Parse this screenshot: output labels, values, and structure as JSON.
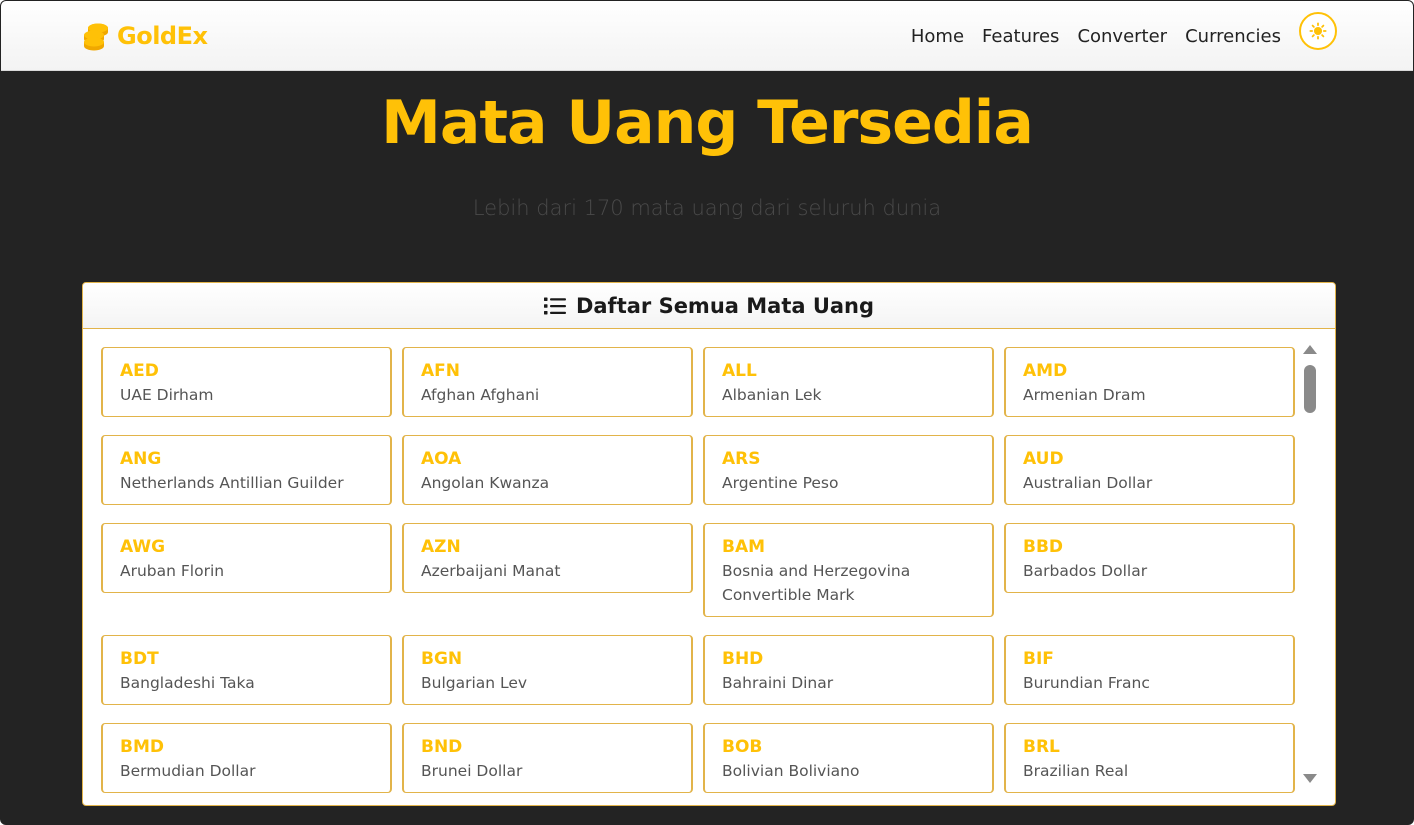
{
  "navbar": {
    "brand": "GoldEx",
    "links": [
      "Home",
      "Features",
      "Converter",
      "Currencies"
    ],
    "theme_toggle_icon": "sun-icon"
  },
  "hero": {
    "title": "Mata Uang Tersedia",
    "subtitle": "Lebih dari 170 mata uang dari seluruh dunia"
  },
  "panel": {
    "icon": "list-icon",
    "title": "Daftar Semua Mata Uang",
    "currencies": [
      {
        "code": "AED",
        "name": "UAE Dirham"
      },
      {
        "code": "AFN",
        "name": "Afghan Afghani"
      },
      {
        "code": "ALL",
        "name": "Albanian Lek"
      },
      {
        "code": "AMD",
        "name": "Armenian Dram"
      },
      {
        "code": "ANG",
        "name": "Netherlands Antillian Guilder"
      },
      {
        "code": "AOA",
        "name": "Angolan Kwanza"
      },
      {
        "code": "ARS",
        "name": "Argentine Peso"
      },
      {
        "code": "AUD",
        "name": "Australian Dollar"
      },
      {
        "code": "AWG",
        "name": "Aruban Florin"
      },
      {
        "code": "AZN",
        "name": "Azerbaijani Manat"
      },
      {
        "code": "BAM",
        "name": "Bosnia and Herzegovina Convertible Mark"
      },
      {
        "code": "BBD",
        "name": "Barbados Dollar"
      },
      {
        "code": "BDT",
        "name": "Bangladeshi Taka"
      },
      {
        "code": "BGN",
        "name": "Bulgarian Lev"
      },
      {
        "code": "BHD",
        "name": "Bahraini Dinar"
      },
      {
        "code": "BIF",
        "name": "Burundian Franc"
      },
      {
        "code": "BMD",
        "name": "Bermudian Dollar"
      },
      {
        "code": "BND",
        "name": "Brunei Dollar"
      },
      {
        "code": "BOB",
        "name": "Bolivian Boliviano"
      },
      {
        "code": "BRL",
        "name": "Brazilian Real"
      }
    ]
  },
  "colors": {
    "accent": "#ffc107",
    "background": "#232323",
    "card_border": "#e2b44a"
  }
}
